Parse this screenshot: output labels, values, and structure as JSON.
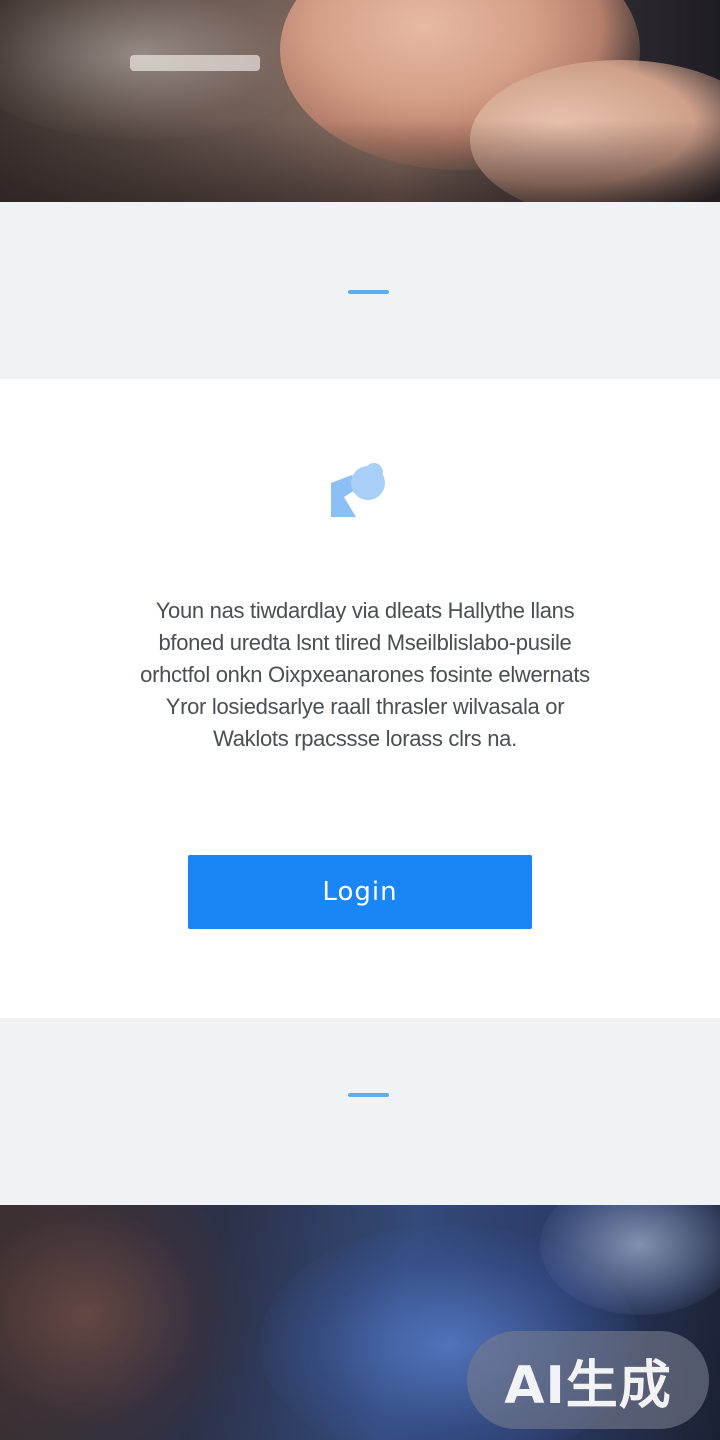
{
  "message": {
    "lines": [
      "Youn nas tiwdardlay via dleats Hallythe llans",
      "bfoned uredta lsnt tlired Mseilblislabo-pusile",
      "orhctfol onkn Oixpxeanarones fosinte elwernats",
      "Yror losiedsarlye raall thrasler wilvasala or",
      "Waklots rpacssse lorass clrs na."
    ]
  },
  "actions": {
    "login_label": "Login"
  },
  "watermark": {
    "text": "AI生成"
  },
  "colors": {
    "accent": "#1a85f5",
    "dash": "#5ab0ee",
    "band_background": "#f0f3f6",
    "card_background": "#ffffff",
    "icon": "#8cc0f5"
  },
  "icons": {
    "card_icon": "speech-bubble-icon"
  }
}
